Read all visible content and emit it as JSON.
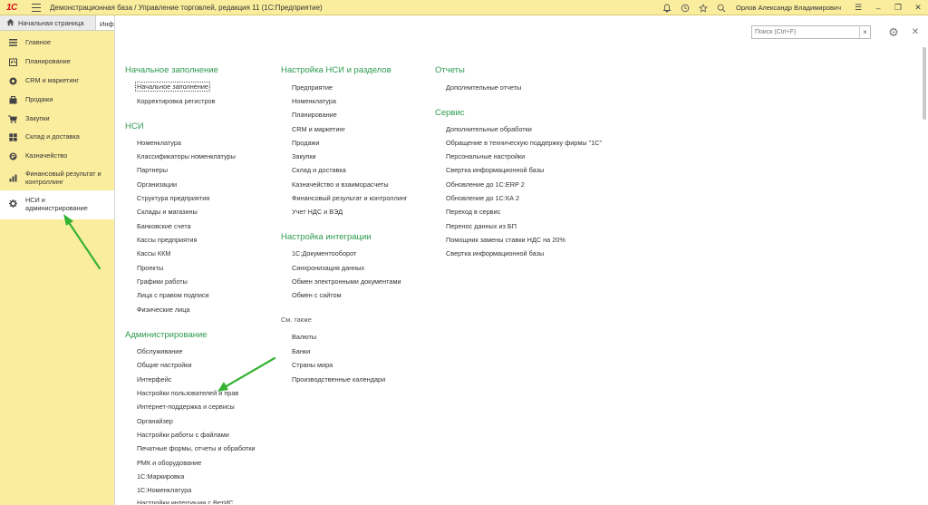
{
  "titlebar": {
    "logo": "1С",
    "title": "Демонстрационная база / Управление торговлей, редакция 11  (1С:Предприятие)",
    "user": "Орлов Александр Владимирович"
  },
  "tabs": {
    "home": "Начальная страница",
    "info": "Инф"
  },
  "sidebar": {
    "items": [
      {
        "label": "Главное",
        "icon": "hamburger-icon"
      },
      {
        "label": "Планирование",
        "icon": "planning-icon"
      },
      {
        "label": "CRM и маркетинг",
        "icon": "crm-icon"
      },
      {
        "label": "Продажи",
        "icon": "sales-icon"
      },
      {
        "label": "Закупки",
        "icon": "cart-icon"
      },
      {
        "label": "Склад и доставка",
        "icon": "warehouse-icon"
      },
      {
        "label": "Казначейство",
        "icon": "treasury-icon"
      },
      {
        "label": "Финансовый результат и контроллинг",
        "icon": "chart-icon"
      },
      {
        "label": "НСИ и администрирование",
        "icon": "gear-icon"
      }
    ]
  },
  "search": {
    "placeholder": "Поиск (Ctrl+F)"
  },
  "sections": {
    "initial": {
      "title": "Начальное заполнение",
      "links": [
        "Начальное заполнение",
        "Корректировка регистров"
      ]
    },
    "nsi": {
      "title": "НСИ",
      "links": [
        "Номенклатура",
        "Классификаторы номенклатуры",
        "Партнеры",
        "Организации",
        "Структура предприятия",
        "Склады и магазины",
        "Банковские счета",
        "Кассы предприятия",
        "Кассы ККМ",
        "Проекты",
        "Графики работы",
        "Лица с правом подписи",
        "Физические лица"
      ]
    },
    "admin": {
      "title": "Администрирование",
      "links": [
        "Обслуживание",
        "Общие настройки",
        "Интерфейс",
        "Настройки пользователей и прав",
        "Интернет-поддержка и сервисы",
        "Органайзер",
        "Настройки работы с файлами",
        "Печатные формы, отчеты и обработки",
        "РМК и оборудование",
        "1С:Маркировка",
        "1С:Номенклатура",
        "Настройки интеграции с ВетИС"
      ]
    },
    "nsi_setup": {
      "title": "Настройка НСИ и разделов",
      "links": [
        "Предприятие",
        "Номенклатура",
        "Планирование",
        "CRM и маркетинг",
        "Продажи",
        "Закупки",
        "Склад и доставка",
        "Казначейство и взаиморасчеты",
        "Финансовый результат и контроллинг",
        "Учет НДС и ВЭД"
      ]
    },
    "integration": {
      "title": "Настройка интеграции",
      "links": [
        "1С:Документооборот",
        "Синхронизация данных",
        "Обмен электронными документами",
        "Обмен с сайтом"
      ]
    },
    "see_also": {
      "title": "См. также",
      "links": [
        "Валюты",
        "Банки",
        "Страны мира",
        "Производственные календари"
      ]
    },
    "reports": {
      "title": "Отчеты",
      "links": [
        "Дополнительные отчеты"
      ]
    },
    "service": {
      "title": "Сервис",
      "links": [
        "Дополнительные обработки",
        "Обращение в техническую поддержку фирмы \"1С\"",
        "Персональные настройки",
        "Свертка информационной базы",
        "Обновление до 1С:ERP 2",
        "Обновление до 1С:КА 2",
        "Переход в сервис",
        "Перенос данных из БП",
        "Помощник замены ставки НДС на 20%",
        "Свертка информационной базы"
      ]
    }
  },
  "colors": {
    "sidebar_bg": "#fbed9e",
    "section_heading": "#2d9a4e",
    "annotation_arrow": "#34b233"
  }
}
